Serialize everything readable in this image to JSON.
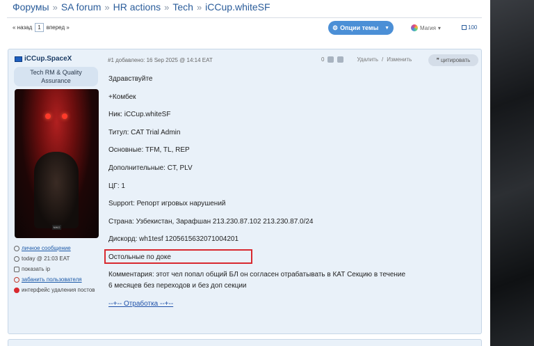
{
  "breadcrumb": [
    "Форумы",
    "SA forum",
    "HR actions",
    "Tech",
    "iCCup.whiteSF"
  ],
  "pager": {
    "prev": "« назад",
    "page": "1",
    "next": "вперед »"
  },
  "toolbar": {
    "options_label": "Опции темы",
    "magic_label": "Магия",
    "count": "100"
  },
  "post": {
    "username": "iCCup.SpaceX",
    "rank": [
      "Tech RM & Quality",
      "Assurance"
    ],
    "meta": "#1 добавлено: 16 Sep 2025 @ 14:14 EAT",
    "votes": "0",
    "delete_label": "Удалить",
    "separator": "/",
    "edit_label": "Изменить",
    "quote_label": "цитировать",
    "sidebar_links": [
      {
        "label": "личное сообщение",
        "link": true
      },
      {
        "label": "today @ 21:03 EAT",
        "link": false
      },
      {
        "label": "показать ip",
        "link": false
      },
      {
        "label": "забанить пользователя",
        "link": true
      },
      {
        "label": "интерфейс удаления постов",
        "link": false
      }
    ],
    "lines": [
      "Здравствуйте",
      "+Комбек",
      "Ник: iCCup.whiteSF",
      "Титул: CAT Trial Admin",
      "Основные: TFM, TL, REP",
      "Дополнительные: CT, PLV",
      "ЦГ: 1",
      "Support: Репорт игровых нарушений",
      "Страна: Узбекистан, Зарафшан 213.230.87.102 213.230.87.0/24",
      "Дискорд: wh1tesf 1205615632071004201",
      "Остольные по доке"
    ],
    "comment": [
      "Комментария: этот чел попал общий БЛ он согласен отрабатывать в КАТ Секцию в течение",
      "6 месяцев без переходов и без доп секции"
    ],
    "footer_link": "--+-- Отработка --+--",
    "avatar_caption": "NIKO"
  },
  "colors": {
    "accent": "#4b8fd6",
    "link": "#2a5c9a",
    "highlight": "#d8292f",
    "post_bg": "#e9f1f9"
  }
}
